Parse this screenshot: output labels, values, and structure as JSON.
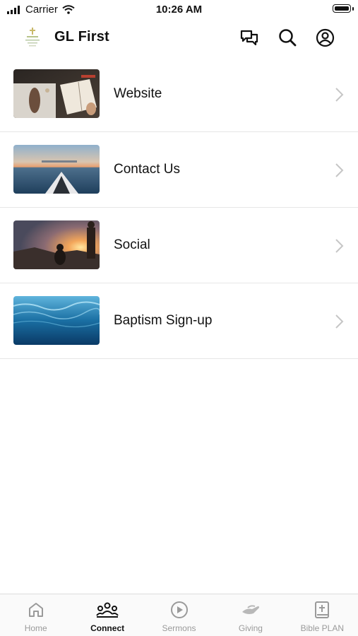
{
  "status_bar": {
    "carrier": "Carrier",
    "time": "10:26 AM"
  },
  "header": {
    "title": "GL First",
    "icons": [
      "chat-icon",
      "search-icon",
      "profile-icon"
    ]
  },
  "list": {
    "items": [
      {
        "label": "Website",
        "thumbnail": "open-bible-photo"
      },
      {
        "label": "Contact Us",
        "thumbnail": "kayak-sea-photo"
      },
      {
        "label": "Social",
        "thumbnail": "sunset-people-photo"
      },
      {
        "label": "Baptism Sign-up",
        "thumbnail": "underwater-photo"
      }
    ]
  },
  "tabbar": {
    "tabs": [
      {
        "label": "Home",
        "icon": "home-icon",
        "active": false
      },
      {
        "label": "Connect",
        "icon": "group-icon",
        "active": true
      },
      {
        "label": "Sermons",
        "icon": "play-icon",
        "active": false
      },
      {
        "label": "Giving",
        "icon": "giving-hand-icon",
        "active": false
      },
      {
        "label": "Bible PLAN",
        "icon": "bible-icon",
        "active": false
      }
    ]
  },
  "colors": {
    "active": "#111111",
    "inactive": "#9a9a9a",
    "divider": "#e6e6e6"
  }
}
